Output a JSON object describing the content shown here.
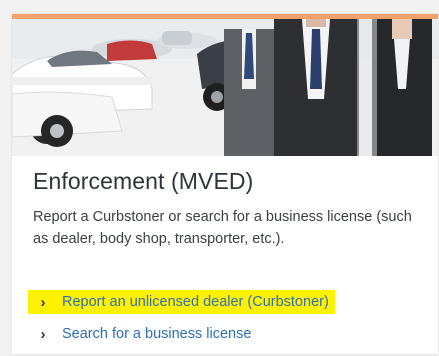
{
  "card": {
    "title": "Enforcement (MVED)",
    "description": "Report a Curbstoner or search for a business license (such as dealer, body shop, transporter, etc.).",
    "links": [
      {
        "label": "Report an unlicensed dealer (Curbstoner)",
        "icon": "chevron-right-icon",
        "highlighted": true
      },
      {
        "label": "Search for a business license",
        "icon": "chevron-right-icon",
        "highlighted": false
      }
    ]
  },
  "colors": {
    "accent_bar": "#f3a26a",
    "link": "#2e6fb3",
    "highlight": "#fff200",
    "heading": "#2f3438"
  },
  "hero_image": {
    "icon": "car-dealership-photo"
  }
}
